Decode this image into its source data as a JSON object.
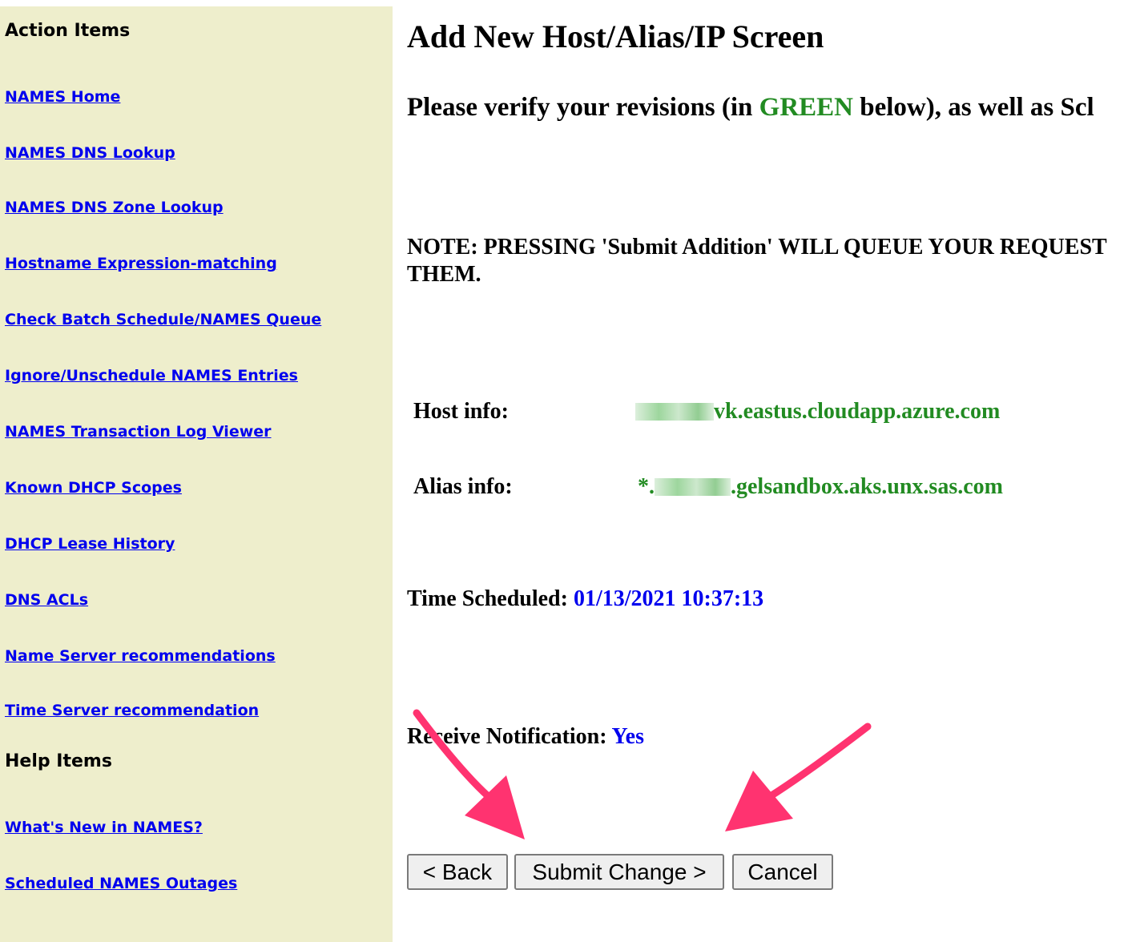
{
  "sidebar": {
    "action_heading": "Action Items",
    "action_links": [
      "NAMES Home",
      "NAMES DNS Lookup",
      "NAMES DNS Zone Lookup",
      "Hostname Expression-matching",
      "Check Batch Schedule/NAMES Queue",
      "Ignore/Unschedule NAMES Entries",
      "NAMES Transaction Log Viewer",
      "Known DHCP Scopes",
      "DHCP Lease History",
      "DNS ACLs",
      "Name Server recommendations",
      "Time Server recommendation"
    ],
    "help_heading": "Help Items",
    "help_links": [
      "What's New in NAMES?",
      "Scheduled NAMES Outages"
    ]
  },
  "main": {
    "title": "Add New Host/Alias/IP Screen",
    "verify_prefix": "Please verify your revisions (in ",
    "verify_highlight": "GREEN",
    "verify_suffix": " below), as well as Scl",
    "note_line1": "NOTE: PRESSING 'Submit Addition' WILL QUEUE YOUR REQUEST",
    "note_line2": "THEM.",
    "host_label": "Host info:",
    "host_value": "vk.eastus.cloudapp.azure.com",
    "alias_label": "Alias info:",
    "alias_prefix": "*.",
    "alias_value": ".gelsandbox.aks.unx.sas.com",
    "time_label": "Time Scheduled: ",
    "time_value": "01/13/2021 10:37:13",
    "notify_label": "Receive Notification: ",
    "notify_value": "Yes"
  },
  "buttons": {
    "back": "< Back",
    "submit": "Submit Change >",
    "cancel": "Cancel"
  },
  "colors": {
    "sidebar_bg": "#eeeecc",
    "link": "#0000ee",
    "highlight_green": "#228b22",
    "annotation_arrow": "#ff3370"
  }
}
